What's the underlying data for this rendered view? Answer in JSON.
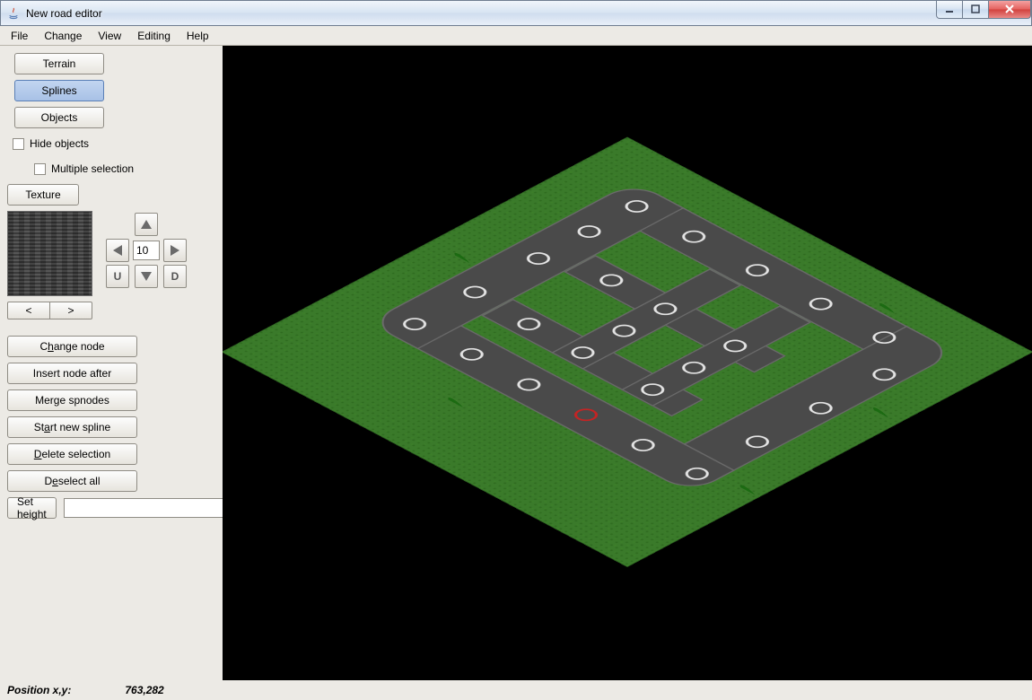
{
  "window": {
    "title": "New road editor"
  },
  "menubar": {
    "items": [
      "File",
      "Change",
      "View",
      "Editing",
      "Help"
    ]
  },
  "sidebar": {
    "mode_buttons": {
      "terrain": "Terrain",
      "splines": "Splines",
      "objects": "Objects"
    },
    "selected_mode": "splines",
    "hide_objects_label": "Hide objects",
    "hide_objects_checked": false,
    "multiple_selection_label": "Multiple selection",
    "multiple_selection_checked": false,
    "texture_button": "Texture",
    "texture_prev": "<",
    "texture_next": ">",
    "step_value": "10",
    "u_label": "U",
    "d_label": "D",
    "actions": {
      "change_node": "Change node",
      "insert_node_after": "Insert node after",
      "merge_spnodes": "Merge spnodes",
      "start_new_spline": "Start new spline",
      "delete_selection": "Delete selection",
      "deselect_all": "Deselect all",
      "set_height": "Set height"
    },
    "mnemonics": {
      "change_node": "h",
      "start_new_spline": "a",
      "delete_selection": "D",
      "deselect_all": "e"
    },
    "height_value": ""
  },
  "status": {
    "label": "Position x,y:",
    "value": "763,282"
  },
  "viewport": {
    "nodes_count_visible": 28,
    "selected_node_index": 24
  }
}
